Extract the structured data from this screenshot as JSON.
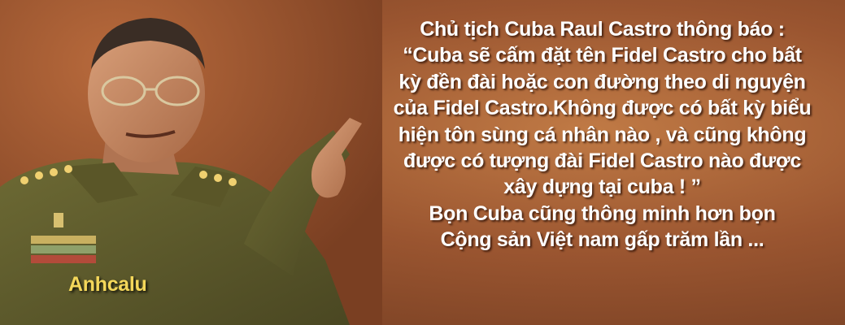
{
  "caption": {
    "lines": [
      "Chủ tịch Cuba Raul Castro thông báo :",
      "“Cuba sẽ cấm đặt tên Fidel Castro cho bất",
      "kỳ đền đài hoặc con đường theo di nguyện",
      "của Fidel Castro.Không được có bất kỳ biểu",
      "hiện tôn sùng cá nhân nào , và cũng không",
      "được có tượng đài Fidel Castro nào được",
      "xây dựng tại cuba ! ”",
      "Bọn Cuba cũng thông minh hơn bọn",
      "Cộng sản Việt nam gấp trăm lần ..."
    ]
  },
  "signature": "Anhcalu",
  "colors": {
    "background": "#9a5530",
    "caption_text": "#ffffff",
    "signature_text": "#f4d75a",
    "uniform": "#5e5a2c"
  }
}
